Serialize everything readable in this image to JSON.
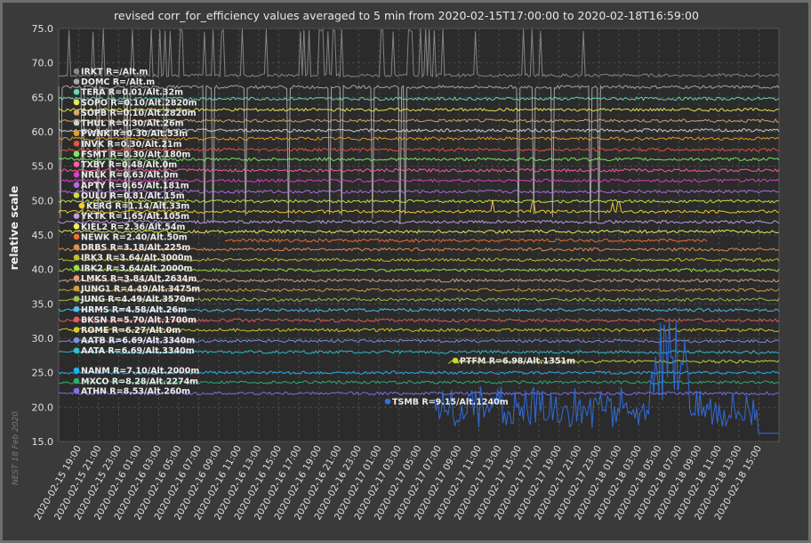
{
  "chart_data": {
    "type": "line",
    "title": "revised corr_for_efficiency values averaged to 5 min from 2020-02-15T17:00:00 to 2020-02-18T16:59:00",
    "ylabel": "relative scale",
    "xlabel": "",
    "ylim": [
      15.0,
      75.0
    ],
    "yticks": [
      "15.0",
      "20.0",
      "25.0",
      "30.0",
      "35.0",
      "40.0",
      "45.0",
      "50.0",
      "55.0",
      "60.0",
      "65.0",
      "70.0",
      "75.0"
    ],
    "xlim": [
      "2020-02-15 17:00",
      "2020-02-18 16:59"
    ],
    "xticks": [
      "2020-02-15 19:00",
      "2020-02-15 21:00",
      "2020-02-15 23:00",
      "2020-02-16 01:00",
      "2020-02-16 03:00",
      "2020-02-16 05:00",
      "2020-02-16 07:00",
      "2020-02-16 09:00",
      "2020-02-16 11:00",
      "2020-02-16 13:00",
      "2020-02-16 15:00",
      "2020-02-16 17:00",
      "2020-02-16 19:00",
      "2020-02-16 21:00",
      "2020-02-16 23:00",
      "2020-02-17 01:00",
      "2020-02-17 03:00",
      "2020-02-17 05:00",
      "2020-02-17 07:00",
      "2020-02-17 09:00",
      "2020-02-17 11:00",
      "2020-02-17 13:00",
      "2020-02-17 15:00",
      "2020-02-17 17:00",
      "2020-02-17 19:00",
      "2020-02-17 21:00",
      "2020-02-17 23:00",
      "2020-02-18 01:00",
      "2020-02-18 03:00",
      "2020-02-18 05:00",
      "2020-02-18 07:00",
      "2020-02-18 09:00",
      "2020-02-18 11:00",
      "2020-02-18 13:00",
      "2020-02-18 15:00"
    ],
    "grid": true,
    "legend_placement": "inside-left",
    "watermark": "NEST 18 Feb 2020",
    "series": [
      {
        "name": "IRKT R=/Alt.m",
        "color": "#888888",
        "level": 68.2
      },
      {
        "name": "DOMC R=/Alt.m",
        "color": "#a8a8a8",
        "level": 66.5
      },
      {
        "name": "TERA R=0.01/Alt.32m",
        "color": "#66d9b8",
        "level": 64.8
      },
      {
        "name": "SOPO R=0.10/Alt.2820m",
        "color": "#e8e855",
        "level": 63.2
      },
      {
        "name": "SOPB R=0.10/Alt.2820m",
        "color": "#d8a868",
        "level": 61.6
      },
      {
        "name": "THUL R=0.30/Alt.26m",
        "color": "#d0d0d0",
        "level": 60.2
      },
      {
        "name": "PWNK R=0.30/Alt.53m",
        "color": "#e8a020",
        "level": 59.0
      },
      {
        "name": "INVK R=0.30/Alt.21m",
        "color": "#e85540",
        "level": 57.4
      },
      {
        "name": "FSMT R=0.30/Alt.180m",
        "color": "#80e860",
        "level": 56.0
      },
      {
        "name": "TXBY R=0.48/Alt.0m",
        "color": "#ff5fa0",
        "level": 54.4
      },
      {
        "name": "NRLK R=0.63/Alt.0m",
        "color": "#e040c0",
        "level": 52.9
      },
      {
        "name": "APTY R=0.65/Alt.181m",
        "color": "#b070e0",
        "level": 51.3
      },
      {
        "name": "OULU R=0.81/Alt.15m",
        "color": "#c8e040",
        "level": 49.9
      },
      {
        "name": "KERG R=1.14/Alt.33m",
        "color": "#f0d030",
        "level": 48.4
      },
      {
        "name": "YKTK R=1.65/Alt.105m",
        "color": "#c0a0e0",
        "level": 46.9
      },
      {
        "name": "KIEL2 R=2.36/Alt.54m",
        "color": "#f0f060",
        "level": 45.5
      },
      {
        "name": "NEWK R=2.40/Alt.50m",
        "color": "#f07030",
        "level": 44.2
      },
      {
        "name": "DRBS R=3.18/Alt.225m",
        "color": "#e09050",
        "level": 42.9
      },
      {
        "name": "IRK3 R=3.64/Alt.3000m",
        "color": "#c0c030",
        "level": 41.4
      },
      {
        "name": "IRK2 R=3.64/Alt.2000m",
        "color": "#a0e040",
        "level": 39.9
      },
      {
        "name": "LMKS R=3.84/Alt.2634m",
        "color": "#e0a080",
        "level": 38.4
      },
      {
        "name": "JUNG1 R=4.49/Alt.3475m",
        "color": "#d0a040",
        "level": 37.0
      },
      {
        "name": "JUNG R=4.49/Alt.3570m",
        "color": "#a0c050",
        "level": 35.6
      },
      {
        "name": "HRMS R=4.58/Alt.26m",
        "color": "#50c0f0",
        "level": 34.1
      },
      {
        "name": "BKSN R=5.70/Alt.1700m",
        "color": "#e06060",
        "level": 32.6
      },
      {
        "name": "ROME R=6.27/Alt.0m",
        "color": "#d0d020",
        "level": 31.2
      },
      {
        "name": "AATB R=6.69/Alt.3340m",
        "color": "#8090e0",
        "level": 29.6
      },
      {
        "name": "AATA R=6.69/Alt.3340m",
        "color": "#30c0d0",
        "level": 28.0
      },
      {
        "name": "PTFM R=6.98/Alt.1351m",
        "color": "#c8d830",
        "level": 26.6
      },
      {
        "name": "NANM R=7.10/Alt.2000m",
        "color": "#20b0f0",
        "level": 25.0
      },
      {
        "name": "MXCO R=8.28/Alt.2274m",
        "color": "#30b070",
        "level": 23.6
      },
      {
        "name": "ATHN R=8.53/Alt.260m",
        "color": "#8070f0",
        "level": 22.0
      },
      {
        "name": "TSMB R=9.15/Alt.1240m",
        "color": "#3070e0",
        "level": 19.5
      }
    ]
  }
}
